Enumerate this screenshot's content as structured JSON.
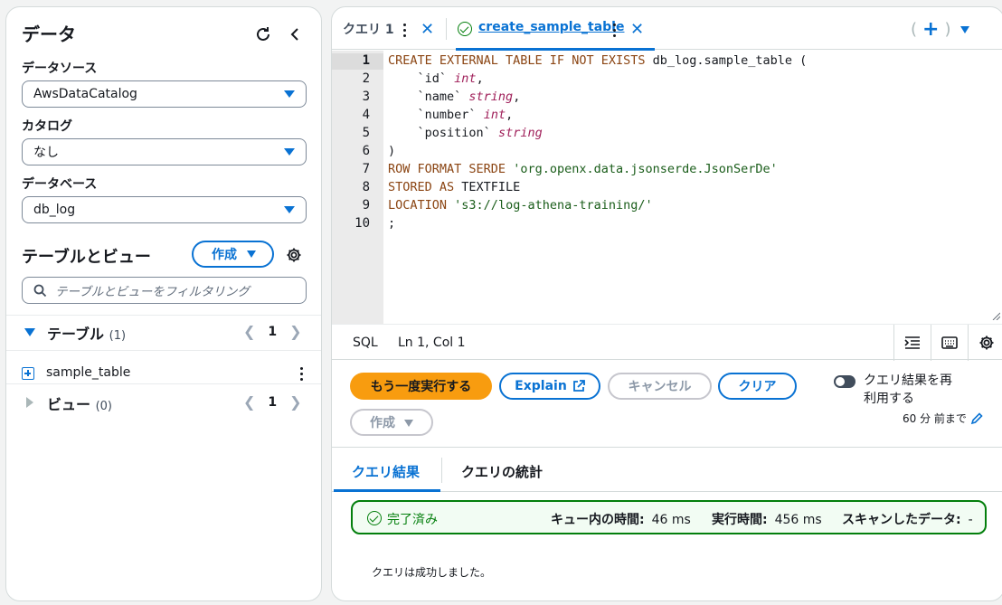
{
  "left_panel": {
    "title": "データ",
    "data_source": {
      "label": "データソース",
      "value": "AwsDataCatalog"
    },
    "catalog": {
      "label": "カタログ",
      "value": "なし"
    },
    "database": {
      "label": "データベース",
      "value": "db_log"
    },
    "tables_views": {
      "title": "テーブルとビュー",
      "create_label": "作成",
      "search_placeholder": "テーブルとビューをフィルタリング",
      "tables_section": {
        "label": "テーブル",
        "count": "(1)",
        "page": "1"
      },
      "tables": [
        {
          "name": "sample_table"
        }
      ],
      "views_section": {
        "label": "ビュー",
        "count": "(0)",
        "page": "1"
      }
    }
  },
  "tabs": [
    {
      "label": "クエリ 1"
    },
    {
      "label": "create_sample_table",
      "active": true,
      "status": "success"
    }
  ],
  "editor": {
    "line_numbers": [
      "1",
      "2",
      "3",
      "4",
      "5",
      "6",
      "7",
      "8",
      "9",
      "10"
    ],
    "language": "SQL",
    "cursor": "Ln 1, Col 1"
  },
  "code": {
    "l1": {
      "kw": "CREATE EXTERNAL TABLE IF NOT EXISTS",
      "rest": " db_log.sample_table ("
    },
    "l2": {
      "col": "    `id`",
      "type": "int",
      "end": ","
    },
    "l3": {
      "col": "    `name`",
      "type": "string",
      "end": ","
    },
    "l4": {
      "col": "    `number`",
      "type": "int",
      "end": ","
    },
    "l5": {
      "col": "    `position`",
      "type": "string",
      "end": ""
    },
    "l6": ")",
    "l7": {
      "kw": "ROW FORMAT SERDE",
      "str": "'org.openx.data.jsonserde.JsonSerDe'"
    },
    "l8": {
      "kw": "STORED AS",
      "rest": " TEXTFILE"
    },
    "l9": {
      "kw": "LOCATION",
      "str": "'s3://log-athena-training/'"
    },
    "l10": ";"
  },
  "actions": {
    "run_again": "もう一度実行する",
    "explain": "Explain",
    "cancel": "キャンセル",
    "clear": "クリア",
    "create": "作成",
    "reuse_results": "クエリ結果を再利用する",
    "reuse_age": "60 分 前まで"
  },
  "results": {
    "tabs": [
      "クエリ結果",
      "クエリの統計"
    ],
    "status": "完了済み",
    "queue_time_label": "キュー内の時間:",
    "queue_time_value": "46 ms",
    "run_time_label": "実行時間:",
    "run_time_value": "456 ms",
    "scanned_label": "スキャンしたデータ:",
    "scanned_value": "-",
    "message": "クエリは成功しました。"
  },
  "colors": {
    "accent": "#0972d3",
    "primary_button": "#f89c0f",
    "success": "#037f0c"
  }
}
